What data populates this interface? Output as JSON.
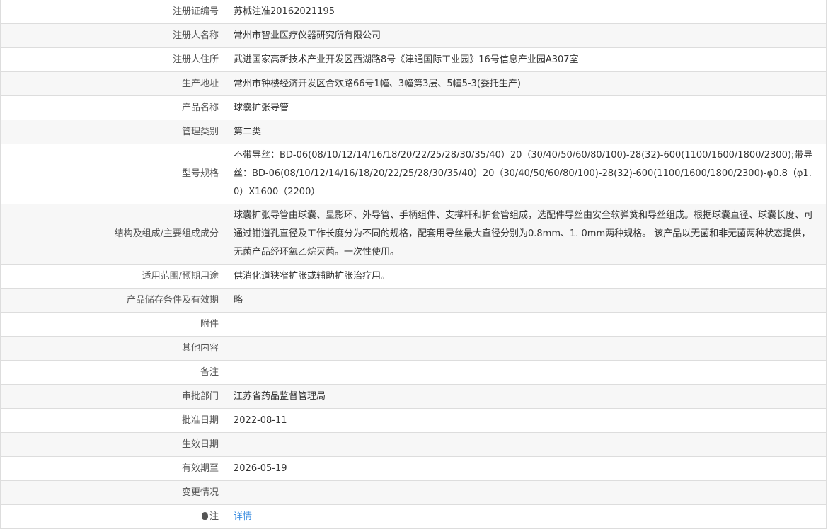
{
  "rows": [
    {
      "label": "注册证编号",
      "value": "苏械注准20162021195"
    },
    {
      "label": "注册人名称",
      "value": "常州市智业医疗仪器研究所有限公司"
    },
    {
      "label": "注册人住所",
      "value": "武进国家高新技术产业开发区西湖路8号《津通国际工业园》16号信息产业园A307室"
    },
    {
      "label": "生产地址",
      "value": "常州市钟楼经济开发区合欢路66号1幢、3幢第3层、5幢5-3(委托生产)"
    },
    {
      "label": "产品名称",
      "value": "球囊扩张导管"
    },
    {
      "label": "管理类别",
      "value": "第二类"
    },
    {
      "label": "型号规格",
      "value": "不带导丝：BD-06(08/10/12/14/16/18/20/22/25/28/30/35/40）20（30/40/50/60/80/100)-28(32)-600(1100/1600/1800/2300);带导丝：BD-06(08/10/12/14/16/18/20/22/25/28/30/35/40）20（30/40/50/60/80/100)-28(32)-600(1100/1600/1800/2300)-φ0.8（φ1.0）X1600（2200）"
    },
    {
      "label": "结构及组成/主要组成成分",
      "value": "球囊扩张导管由球囊、显影环、外导管、手柄组件、支撑杆和护套管组成，选配件导丝由安全软弹簧和导丝组成。根据球囊直径、球囊长度、可通过钳道孔直径及工作长度分为不同的规格，配套用导丝最大直径分别为0.8mm、1. 0mm两种规格。 该产品以无菌和非无菌两种状态提供，无菌产品经环氧乙烷灭菌。一次性使用。"
    },
    {
      "label": "适用范围/预期用途",
      "value": "供消化道狭窄扩张或辅助扩张治疗用。"
    },
    {
      "label": "产品储存条件及有效期",
      "value": "略"
    },
    {
      "label": "附件",
      "value": ""
    },
    {
      "label": "其他内容",
      "value": ""
    },
    {
      "label": "备注",
      "value": ""
    },
    {
      "label": "审批部门",
      "value": "江苏省药品监督管理局"
    },
    {
      "label": "批准日期",
      "value": "2022-08-11"
    },
    {
      "label": "生效日期",
      "value": ""
    },
    {
      "label": "有效期至",
      "value": "2026-05-19"
    },
    {
      "label": "变更情况",
      "value": ""
    }
  ],
  "note": {
    "label": "注",
    "link": "详情"
  }
}
